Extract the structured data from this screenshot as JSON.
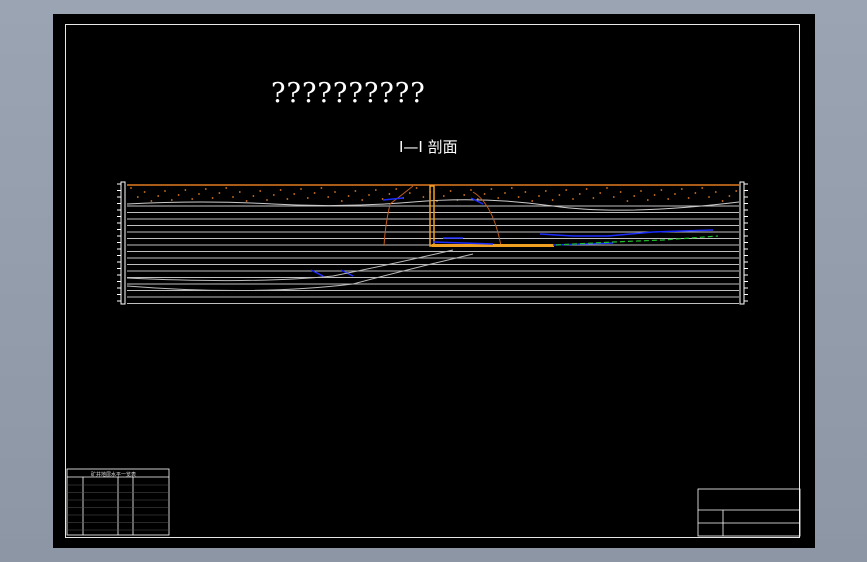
{
  "drawing": {
    "title": "??????????",
    "section_label": "I—I 剖面"
  },
  "colors": {
    "background": "#000000",
    "frame": "#ffffff",
    "topsoil": "#e07b20",
    "water": "#1a2cff",
    "green_line": "#1fbf2a",
    "shaft": "#f0a020",
    "strata_lines": "#ffffff"
  },
  "legend_table": {
    "header": "矿井地层水平一览表"
  },
  "title_block": {
    "labels": [
      "?",
      "?",
      "?",
      "?",
      "?",
      "?",
      "?",
      "?"
    ]
  }
}
